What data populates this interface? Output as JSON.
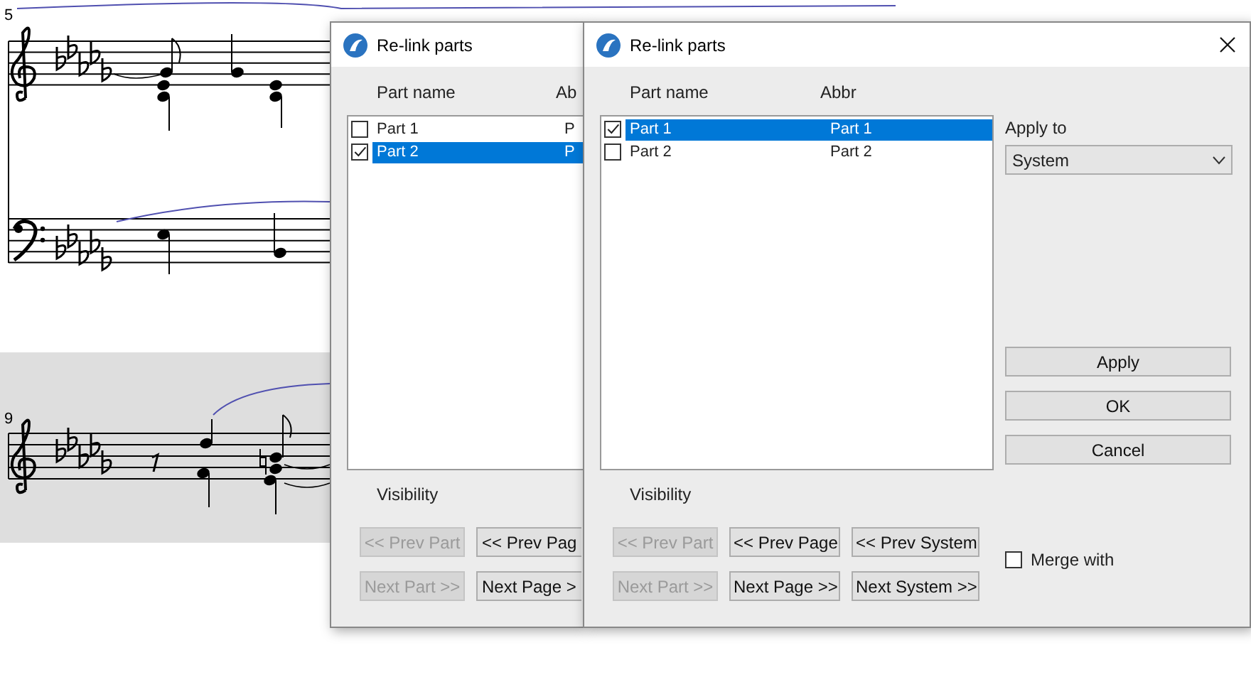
{
  "score": {
    "systems": [
      {
        "measure_number": "5",
        "highlighted": false
      },
      {
        "measure_number": "9",
        "highlighted": true
      }
    ]
  },
  "dialogs": [
    {
      "title": "Re-link parts",
      "columns": [
        "Part name",
        "Ab"
      ],
      "parts": [
        {
          "name": "Part 1",
          "abbr": "P",
          "checked": false,
          "selected": false
        },
        {
          "name": "Part 2",
          "abbr": "P",
          "checked": true,
          "selected": true
        }
      ],
      "visibility_label": "Visibility",
      "nav_buttons": [
        {
          "label": "<< Prev Part",
          "disabled": true
        },
        {
          "label": "<< Prev Pag",
          "disabled": false
        },
        {
          "label": "Next Part >>",
          "disabled": true
        },
        {
          "label": "Next Page >",
          "disabled": false
        }
      ]
    },
    {
      "title": "Re-link parts",
      "columns": [
        "Part name",
        "Abbr"
      ],
      "parts": [
        {
          "name": "Part 1",
          "abbr": "Part 1",
          "checked": true,
          "selected": true
        },
        {
          "name": "Part 2",
          "abbr": "Part 2",
          "checked": false,
          "selected": false
        }
      ],
      "visibility_label": "Visibility",
      "nav_buttons": [
        {
          "label": "<< Prev Part",
          "disabled": true
        },
        {
          "label": "<< Prev Page",
          "disabled": false
        },
        {
          "label": "<< Prev System",
          "disabled": false
        },
        {
          "label": "Next Part >>",
          "disabled": true
        },
        {
          "label": "Next Page >>",
          "disabled": false
        },
        {
          "label": "Next System >>",
          "disabled": false
        }
      ],
      "apply_to": {
        "label": "Apply to",
        "value": "System"
      },
      "actions": [
        "Apply",
        "OK",
        "Cancel"
      ],
      "merge": {
        "label": "Merge with",
        "checked": false
      }
    }
  ]
}
